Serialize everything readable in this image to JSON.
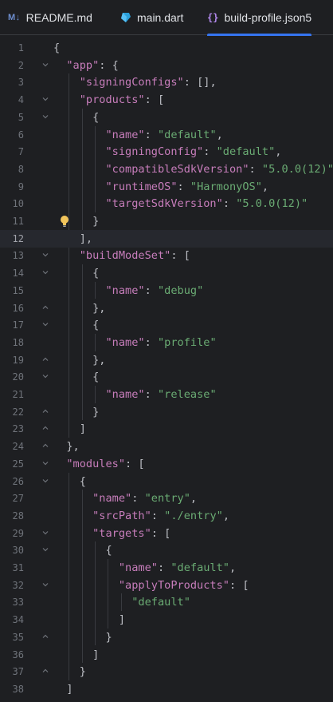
{
  "tabs": [
    {
      "icon": "markdown-icon",
      "icon_text": "M↓",
      "label": "README.md",
      "active": false
    },
    {
      "icon": "dart-icon",
      "label": "main.dart",
      "active": false
    },
    {
      "icon": "json5-icon",
      "icon_text": "{}",
      "label": "build-profile.json5",
      "active": true
    }
  ],
  "editor": {
    "current_line": 12,
    "lines": [
      {
        "n": "1",
        "code": [
          [
            "p",
            "{"
          ]
        ]
      },
      {
        "n": "2",
        "code": [
          [
            "p",
            "  "
          ],
          [
            "k",
            "\"app\""
          ],
          [
            "p",
            ": {"
          ]
        ]
      },
      {
        "n": "3",
        "code": [
          [
            "p",
            "    "
          ],
          [
            "k",
            "\"signingConfigs\""
          ],
          [
            "p",
            ": [],"
          ]
        ]
      },
      {
        "n": "4",
        "code": [
          [
            "p",
            "    "
          ],
          [
            "k",
            "\"products\""
          ],
          [
            "p",
            ": ["
          ]
        ]
      },
      {
        "n": "5",
        "code": [
          [
            "p",
            "      {"
          ]
        ]
      },
      {
        "n": "6",
        "code": [
          [
            "p",
            "        "
          ],
          [
            "k",
            "\"name\""
          ],
          [
            "p",
            ": "
          ],
          [
            "s",
            "\"default\""
          ],
          [
            "p",
            ","
          ]
        ]
      },
      {
        "n": "7",
        "code": [
          [
            "p",
            "        "
          ],
          [
            "k",
            "\"signingConfig\""
          ],
          [
            "p",
            ": "
          ],
          [
            "s",
            "\"default\""
          ],
          [
            "p",
            ","
          ]
        ]
      },
      {
        "n": "8",
        "code": [
          [
            "p",
            "        "
          ],
          [
            "k",
            "\"compatibleSdkVersion\""
          ],
          [
            "p",
            ": "
          ],
          [
            "s",
            "\"5.0.0(12)\""
          ],
          [
            "p",
            ","
          ]
        ]
      },
      {
        "n": "9",
        "code": [
          [
            "p",
            "        "
          ],
          [
            "k",
            "\"runtimeOS\""
          ],
          [
            "p",
            ": "
          ],
          [
            "s",
            "\"HarmonyOS\""
          ],
          [
            "p",
            ","
          ]
        ]
      },
      {
        "n": "10",
        "code": [
          [
            "p",
            "        "
          ],
          [
            "k",
            "\"targetSdkVersion\""
          ],
          [
            "p",
            ": "
          ],
          [
            "s",
            "\"5.0.0(12)\""
          ]
        ]
      },
      {
        "n": "11",
        "code": [
          [
            "p",
            "      }"
          ]
        ]
      },
      {
        "n": "12",
        "code": [
          [
            "p",
            "    ],"
          ]
        ]
      },
      {
        "n": "13",
        "code": [
          [
            "p",
            "    "
          ],
          [
            "k",
            "\"buildModeSet\""
          ],
          [
            "p",
            ": ["
          ]
        ]
      },
      {
        "n": "14",
        "code": [
          [
            "p",
            "      {"
          ]
        ]
      },
      {
        "n": "15",
        "code": [
          [
            "p",
            "        "
          ],
          [
            "k",
            "\"name\""
          ],
          [
            "p",
            ": "
          ],
          [
            "s",
            "\"debug\""
          ]
        ]
      },
      {
        "n": "16",
        "code": [
          [
            "p",
            "      },"
          ]
        ]
      },
      {
        "n": "17",
        "code": [
          [
            "p",
            "      {"
          ]
        ]
      },
      {
        "n": "18",
        "code": [
          [
            "p",
            "        "
          ],
          [
            "k",
            "\"name\""
          ],
          [
            "p",
            ": "
          ],
          [
            "s",
            "\"profile\""
          ]
        ]
      },
      {
        "n": "19",
        "code": [
          [
            "p",
            "      },"
          ]
        ]
      },
      {
        "n": "20",
        "code": [
          [
            "p",
            "      {"
          ]
        ]
      },
      {
        "n": "21",
        "code": [
          [
            "p",
            "        "
          ],
          [
            "k",
            "\"name\""
          ],
          [
            "p",
            ": "
          ],
          [
            "s",
            "\"release\""
          ]
        ]
      },
      {
        "n": "22",
        "code": [
          [
            "p",
            "      }"
          ]
        ]
      },
      {
        "n": "23",
        "code": [
          [
            "p",
            "    ]"
          ]
        ]
      },
      {
        "n": "24",
        "code": [
          [
            "p",
            "  },"
          ]
        ]
      },
      {
        "n": "25",
        "code": [
          [
            "p",
            "  "
          ],
          [
            "k",
            "\"modules\""
          ],
          [
            "p",
            ": ["
          ]
        ]
      },
      {
        "n": "26",
        "code": [
          [
            "p",
            "    {"
          ]
        ]
      },
      {
        "n": "27",
        "code": [
          [
            "p",
            "      "
          ],
          [
            "k",
            "\"name\""
          ],
          [
            "p",
            ": "
          ],
          [
            "s",
            "\"entry\""
          ],
          [
            "p",
            ","
          ]
        ]
      },
      {
        "n": "28",
        "code": [
          [
            "p",
            "      "
          ],
          [
            "k",
            "\"srcPath\""
          ],
          [
            "p",
            ": "
          ],
          [
            "s",
            "\"./entry\""
          ],
          [
            "p",
            ","
          ]
        ]
      },
      {
        "n": "29",
        "code": [
          [
            "p",
            "      "
          ],
          [
            "k",
            "\"targets\""
          ],
          [
            "p",
            ": ["
          ]
        ]
      },
      {
        "n": "30",
        "code": [
          [
            "p",
            "        {"
          ]
        ]
      },
      {
        "n": "31",
        "code": [
          [
            "p",
            "          "
          ],
          [
            "k",
            "\"name\""
          ],
          [
            "p",
            ": "
          ],
          [
            "s",
            "\"default\""
          ],
          [
            "p",
            ","
          ]
        ]
      },
      {
        "n": "32",
        "code": [
          [
            "p",
            "          "
          ],
          [
            "k",
            "\"applyToProducts\""
          ],
          [
            "p",
            ": ["
          ]
        ]
      },
      {
        "n": "33",
        "code": [
          [
            "p",
            "            "
          ],
          [
            "s",
            "\"default\""
          ]
        ]
      },
      {
        "n": "34",
        "code": [
          [
            "p",
            "          ]"
          ]
        ]
      },
      {
        "n": "35",
        "code": [
          [
            "p",
            "        }"
          ]
        ]
      },
      {
        "n": "36",
        "code": [
          [
            "p",
            "      ]"
          ]
        ]
      },
      {
        "n": "37",
        "code": [
          [
            "p",
            "    }"
          ]
        ]
      },
      {
        "n": "38",
        "code": [
          [
            "p",
            "  ]"
          ]
        ]
      }
    ],
    "fold_open_lines": [
      "2",
      "4",
      "5",
      "13",
      "14",
      "17",
      "20",
      "25",
      "26",
      "29",
      "30",
      "32"
    ],
    "fold_close_lines": [
      "16",
      "19",
      "22",
      "23",
      "24",
      "35",
      "37"
    ],
    "intention_bulb_line": "11"
  },
  "colors": {
    "key": "#c77dbb",
    "string": "#6aab73",
    "punct": "#bcbec4",
    "accent": "#3574f0"
  }
}
